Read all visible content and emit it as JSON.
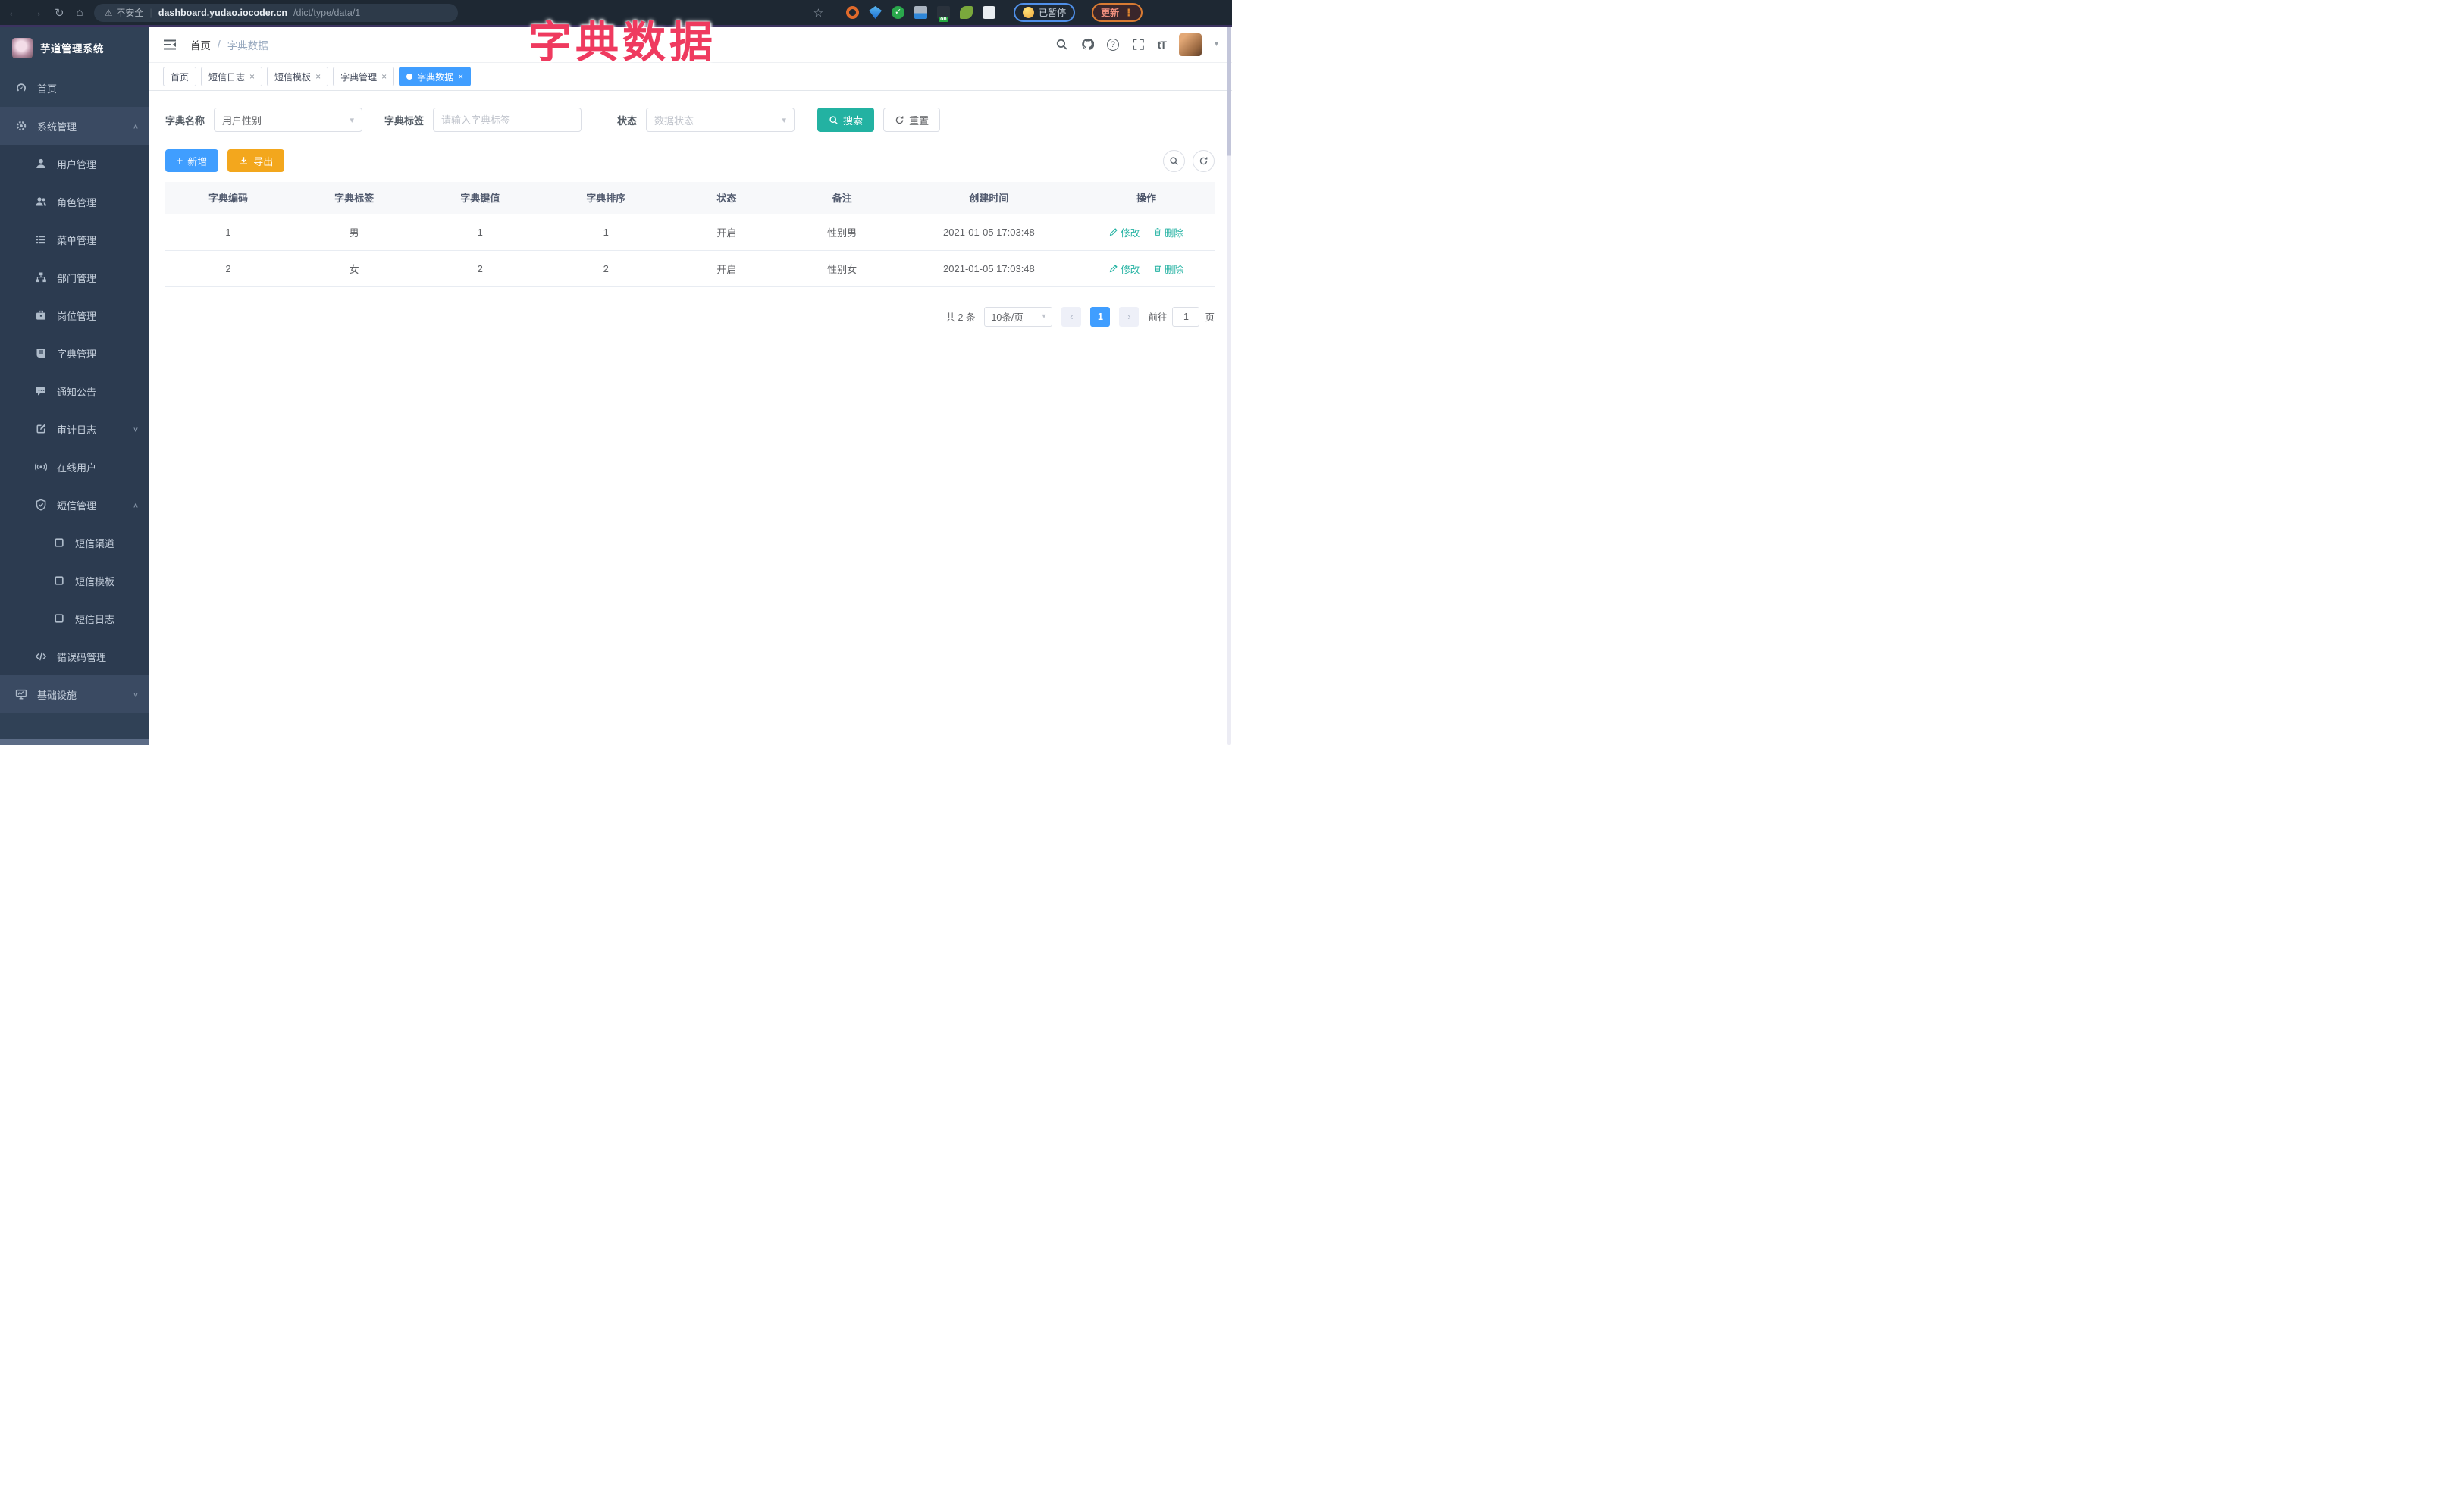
{
  "icons": {
    "back": "←",
    "forward": "→",
    "reload": "↻",
    "home": "⌂",
    "warning": "⚠",
    "divider": "|",
    "star": "☆",
    "on_badge": "on",
    "more_vert": "⋮",
    "caret_down": "▾",
    "caret_small": "▾",
    "breadcrumb_sep": "/",
    "close": "×",
    "plus": "+",
    "prev": "‹",
    "next": "›",
    "arrow_up": "∧",
    "arrow_down": "∨",
    "question": "?",
    "font_size": "tT",
    "check": "✓"
  },
  "colors": {
    "accent_blue": "#409eff",
    "accent_teal": "#23b2a2",
    "accent_orange": "#f3a71d",
    "overlay_pink": "#ef3a5f",
    "sidebar_bg": "#304156",
    "browser_bg": "#1e2833"
  },
  "overlay": {
    "title": "字典数据"
  },
  "browser": {
    "security_label": "不安全",
    "url_host": "dashboard.yudao.iocoder.cn",
    "url_path": "/dict/type/data/1",
    "paused_badge": "已暂停",
    "update_button": "更新"
  },
  "sidebar": {
    "app_title": "芋道管理系统",
    "items": [
      {
        "label": "首页",
        "icon": "dashboard",
        "level": 1
      },
      {
        "label": "系统管理",
        "icon": "gear",
        "level": 1,
        "state": "expanded"
      },
      {
        "label": "用户管理",
        "icon": "user",
        "level": 2
      },
      {
        "label": "角色管理",
        "icon": "users",
        "level": 2
      },
      {
        "label": "菜单管理",
        "icon": "list",
        "level": 2
      },
      {
        "label": "部门管理",
        "icon": "tree",
        "level": 2
      },
      {
        "label": "岗位管理",
        "icon": "briefcase",
        "level": 2
      },
      {
        "label": "字典管理",
        "icon": "book",
        "level": 2
      },
      {
        "label": "通知公告",
        "icon": "megaphone",
        "level": 2
      },
      {
        "label": "审计日志",
        "icon": "edit",
        "level": 2,
        "state": "collapsed"
      },
      {
        "label": "在线用户",
        "icon": "online",
        "level": 2
      },
      {
        "label": "短信管理",
        "icon": "shield",
        "level": 2,
        "state": "expanded"
      },
      {
        "label": "短信渠道",
        "icon": "square",
        "level": 3
      },
      {
        "label": "短信模板",
        "icon": "square",
        "level": 3
      },
      {
        "label": "短信日志",
        "icon": "square",
        "level": 3
      },
      {
        "label": "错误码管理",
        "icon": "code",
        "level": 2
      },
      {
        "label": "基础设施",
        "icon": "monitor",
        "level": 1,
        "state": "collapsed"
      }
    ]
  },
  "header": {
    "breadcrumb": {
      "home": "首页",
      "current": "字典数据"
    }
  },
  "tabs": [
    {
      "label": "首页",
      "closable": false,
      "active": false
    },
    {
      "label": "短信日志",
      "closable": true,
      "active": false
    },
    {
      "label": "短信模板",
      "closable": true,
      "active": false
    },
    {
      "label": "字典管理",
      "closable": true,
      "active": false
    },
    {
      "label": "字典数据",
      "closable": true,
      "active": true
    }
  ],
  "filters": {
    "dict_name_label": "字典名称",
    "dict_name_value": "用户性别",
    "dict_label_label": "字典标签",
    "dict_label_placeholder": "请输入字典标签",
    "status_label": "状态",
    "status_placeholder": "数据状态",
    "search_label": "搜索",
    "reset_label": "重置"
  },
  "toolbar": {
    "add_label": "新增",
    "export_label": "导出"
  },
  "table": {
    "columns": [
      "字典编码",
      "字典标签",
      "字典键值",
      "字典排序",
      "状态",
      "备注",
      "创建时间",
      "操作"
    ],
    "rows": [
      {
        "code": "1",
        "label": "男",
        "value": "1",
        "sort": "1",
        "status": "开启",
        "remark": "性别男",
        "created": "2021-01-05 17:03:48"
      },
      {
        "code": "2",
        "label": "女",
        "value": "2",
        "sort": "2",
        "status": "开启",
        "remark": "性别女",
        "created": "2021-01-05 17:03:48"
      }
    ],
    "edit_label": "修改",
    "delete_label": "删除"
  },
  "pagination": {
    "total": "共 2 条",
    "page_size": "10条/页",
    "current_page": "1",
    "goto_label": "前往",
    "goto_value": "1",
    "page_unit": "页"
  }
}
